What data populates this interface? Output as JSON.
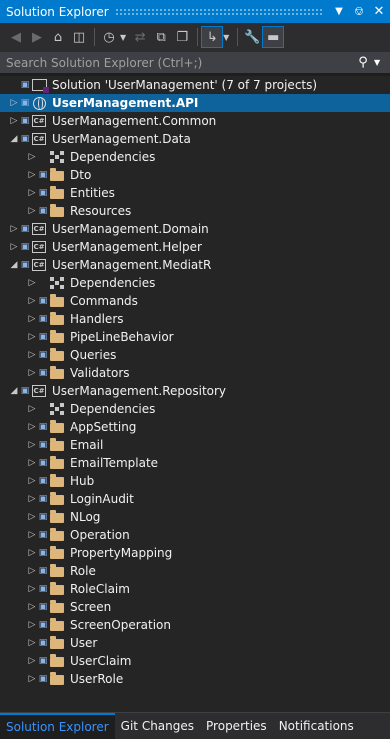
{
  "window": {
    "title": "Solution Explorer",
    "dropdown_icon": "dropdown-arrow-icon",
    "pin_icon": "pin-icon",
    "close_icon": "close-icon"
  },
  "toolbar": {
    "buttons": [
      "back-icon",
      "forward-icon",
      "home-icon",
      "switch-views-icon",
      "pending-changes-filter-icon",
      "sync-icon",
      "collapse-all-icon",
      "show-all-files-icon",
      "preview-icon",
      "properties-icon",
      "collapse-icon"
    ]
  },
  "search": {
    "placeholder": "Search Solution Explorer (Ctrl+;)"
  },
  "tree": [
    {
      "label": "Solution 'UserManagement' (7 of 7 projects)",
      "icon": "solution-icon",
      "expanded": true,
      "level": 0,
      "locked": true
    },
    {
      "label": "UserManagement.API",
      "icon": "web-project-icon",
      "expanded": false,
      "level": 0,
      "locked": true,
      "selected": true
    },
    {
      "label": "UserManagement.Common",
      "icon": "csharp-project-icon",
      "expanded": false,
      "level": 0,
      "locked": true
    },
    {
      "label": "UserManagement.Data",
      "icon": "csharp-project-icon",
      "expanded": true,
      "level": 0,
      "locked": true
    },
    {
      "label": "Dependencies",
      "icon": "dependencies-icon",
      "expanded": false,
      "level": 1,
      "locked": false
    },
    {
      "label": "Dto",
      "icon": "folder-icon",
      "expanded": false,
      "level": 1,
      "locked": true
    },
    {
      "label": "Entities",
      "icon": "folder-icon",
      "expanded": false,
      "level": 1,
      "locked": true
    },
    {
      "label": "Resources",
      "icon": "folder-icon",
      "expanded": false,
      "level": 1,
      "locked": true
    },
    {
      "label": "UserManagement.Domain",
      "icon": "csharp-project-icon",
      "expanded": false,
      "level": 0,
      "locked": true
    },
    {
      "label": "UserManagement.Helper",
      "icon": "csharp-project-icon",
      "expanded": false,
      "level": 0,
      "locked": true
    },
    {
      "label": "UserManagement.MediatR",
      "icon": "csharp-project-icon",
      "expanded": true,
      "level": 0,
      "locked": true
    },
    {
      "label": "Dependencies",
      "icon": "dependencies-icon",
      "expanded": false,
      "level": 1,
      "locked": false
    },
    {
      "label": "Commands",
      "icon": "folder-icon",
      "expanded": false,
      "level": 1,
      "locked": true
    },
    {
      "label": "Handlers",
      "icon": "folder-icon",
      "expanded": false,
      "level": 1,
      "locked": true
    },
    {
      "label": "PipeLineBehavior",
      "icon": "folder-icon",
      "expanded": false,
      "level": 1,
      "locked": true
    },
    {
      "label": "Queries",
      "icon": "folder-icon",
      "expanded": false,
      "level": 1,
      "locked": true
    },
    {
      "label": "Validators",
      "icon": "folder-icon",
      "expanded": false,
      "level": 1,
      "locked": true
    },
    {
      "label": "UserManagement.Repository",
      "icon": "csharp-project-icon",
      "expanded": true,
      "level": 0,
      "locked": true
    },
    {
      "label": "Dependencies",
      "icon": "dependencies-icon",
      "expanded": false,
      "level": 1,
      "locked": false
    },
    {
      "label": "AppSetting",
      "icon": "folder-icon",
      "expanded": false,
      "level": 1,
      "locked": true
    },
    {
      "label": "Email",
      "icon": "folder-icon",
      "expanded": false,
      "level": 1,
      "locked": true
    },
    {
      "label": "EmailTemplate",
      "icon": "folder-icon",
      "expanded": false,
      "level": 1,
      "locked": true
    },
    {
      "label": "Hub",
      "icon": "folder-icon",
      "expanded": false,
      "level": 1,
      "locked": true
    },
    {
      "label": "LoginAudit",
      "icon": "folder-icon",
      "expanded": false,
      "level": 1,
      "locked": true
    },
    {
      "label": "NLog",
      "icon": "folder-icon",
      "expanded": false,
      "level": 1,
      "locked": true
    },
    {
      "label": "Operation",
      "icon": "folder-icon",
      "expanded": false,
      "level": 1,
      "locked": true
    },
    {
      "label": "PropertyMapping",
      "icon": "folder-icon",
      "expanded": false,
      "level": 1,
      "locked": true
    },
    {
      "label": "Role",
      "icon": "folder-icon",
      "expanded": false,
      "level": 1,
      "locked": true
    },
    {
      "label": "RoleClaim",
      "icon": "folder-icon",
      "expanded": false,
      "level": 1,
      "locked": true
    },
    {
      "label": "Screen",
      "icon": "folder-icon",
      "expanded": false,
      "level": 1,
      "locked": true
    },
    {
      "label": "ScreenOperation",
      "icon": "folder-icon",
      "expanded": false,
      "level": 1,
      "locked": true
    },
    {
      "label": "User",
      "icon": "folder-icon",
      "expanded": false,
      "level": 1,
      "locked": true
    },
    {
      "label": "UserClaim",
      "icon": "folder-icon",
      "expanded": false,
      "level": 1,
      "locked": true
    },
    {
      "label": "UserRole",
      "icon": "folder-icon",
      "expanded": false,
      "level": 1,
      "locked": true
    }
  ],
  "tabs": [
    {
      "label": "Solution Explorer",
      "active": true
    },
    {
      "label": "Git Changes",
      "active": false
    },
    {
      "label": "Properties",
      "active": false
    },
    {
      "label": "Notifications",
      "active": false
    }
  ],
  "colors": {
    "accent": "#007acc",
    "selection": "#0e639c",
    "background": "#252526",
    "folder": "#dcb67a",
    "active_tab_text": "#3794ff"
  }
}
